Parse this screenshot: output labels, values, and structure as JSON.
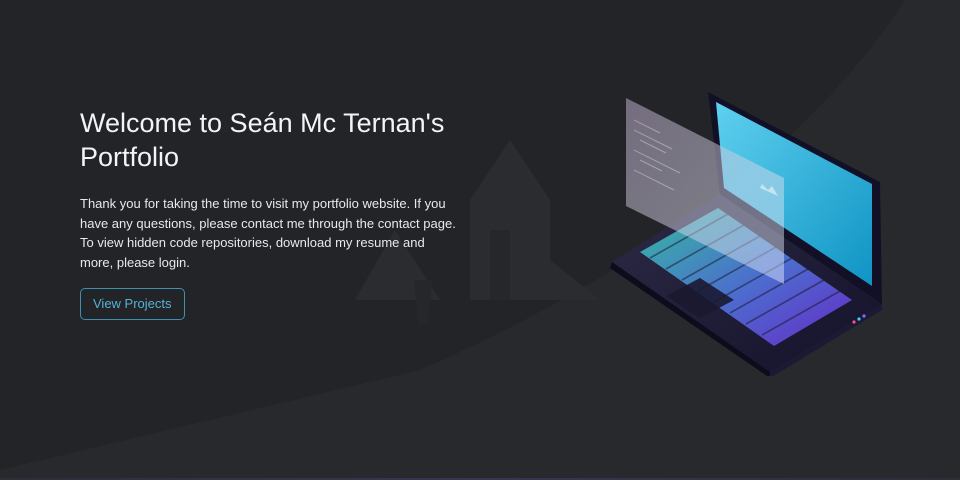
{
  "hero": {
    "title": "Welcome to Seán Mc Ternan's Portfolio",
    "description": "Thank you for taking the time to visit my portfolio website. If you have any questions, please contact me through the contact page. To view hidden code repositories, download my resume and more, please login.",
    "cta_label": "View Projects"
  },
  "colors": {
    "background": "#232427",
    "accent": "#55b1d6",
    "screen": "#2ab0d8",
    "keyboard_gradient_start": "#39c6a8",
    "keyboard_gradient_end": "#6a2bd0"
  },
  "illustration": {
    "name": "isometric-laptop-illustration"
  }
}
